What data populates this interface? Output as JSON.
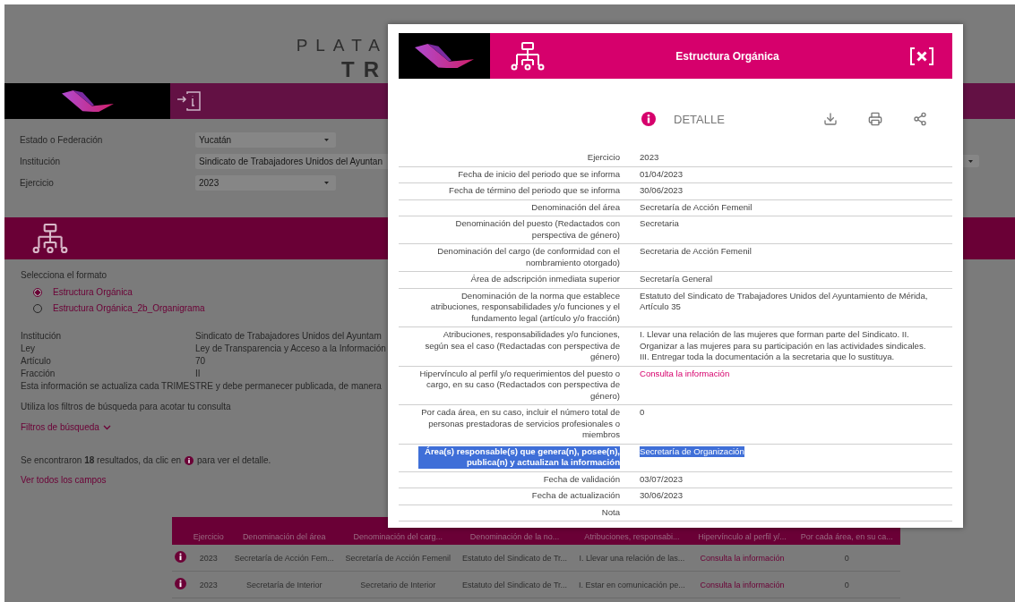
{
  "header": {
    "title_line_1": "PLATA",
    "title_line_2": "TR"
  },
  "filters": [
    {
      "label": "Estado o Federación",
      "value": "Yucatán",
      "kind": "select"
    },
    {
      "label": "Institución",
      "value": "Sindicato de Trabajadores Unidos del Ayuntan",
      "kind": "wide"
    },
    {
      "label": "Ejercicio",
      "value": "2023",
      "kind": "select"
    }
  ],
  "format": {
    "prompt": "Selecciona el formato",
    "options": [
      {
        "label": "Estructura Orgánica",
        "selected": true
      },
      {
        "label": "Estructura Orgánica_2b_Organigrama",
        "selected": false
      }
    ]
  },
  "info": [
    {
      "label": "Institución",
      "value": "Sindicato de Trabajadores Unidos del Ayuntam"
    },
    {
      "label": "Ley",
      "value": "Ley de Transparencia y Acceso a la Información"
    },
    {
      "label": "Artículo",
      "value": "70"
    },
    {
      "label": "Fracción",
      "value": "II"
    }
  ],
  "notice": "Esta información se actualiza cada TRIMESTRE y debe permanecer publicada, de manera",
  "hint": "Utiliza los filtros de búsqueda para acotar tu consulta",
  "filters_link": "Filtros de búsqueda",
  "results_before": "Se encontraron **18** resultados, da clic en",
  "results_after": "para ver el detalle.",
  "all_fields_link": "Ver todos los campos",
  "table": {
    "columns": [
      {
        "label": "Ejercicio",
        "kind": "text"
      },
      {
        "label": "Denominación del área",
        "kind": "text"
      },
      {
        "label": "Denominación del carg...",
        "kind": "text"
      },
      {
        "label": "Denominación de la no...",
        "kind": "text"
      },
      {
        "label": "Atribuciones, responsabi...",
        "kind": "text"
      },
      {
        "label": "Hipervínculo al perfil y/...",
        "kind": "link"
      },
      {
        "label": "Por cada área, en su ca...",
        "kind": "text"
      }
    ],
    "rows": [
      {
        "cells": [
          "2023",
          "Secretaría de Acción Fem...",
          "Secretaría de Acción Femenil",
          "Estatuto del Sindicato de Tr...",
          "I. Llevar una relación de las...",
          "Consulta la información",
          "0"
        ]
      },
      {
        "cells": [
          "2023",
          "Secretaría de Interior",
          "Secretario de Interior",
          "Estatuto del Sindicato de Tr...",
          "I. Estar en comunicación pe...",
          "Consulta la información",
          "0"
        ]
      }
    ]
  },
  "modal": {
    "title": "Estructura Orgánica",
    "section": "DETALLE",
    "rows": [
      {
        "label": "Ejercicio",
        "value": "2023",
        "kind": "text",
        "highlighted": false
      },
      {
        "label": "Fecha de inicio del periodo que se informa",
        "value": "01/04/2023",
        "kind": "text",
        "highlighted": false
      },
      {
        "label": "Fecha de término del periodo que se informa",
        "value": "30/06/2023",
        "kind": "text",
        "highlighted": false
      },
      {
        "label": "Denominación del área",
        "value": "Secretaría de Acción Femenil",
        "kind": "text",
        "highlighted": false
      },
      {
        "label": "Denominación del puesto (Redactados con perspectiva de género)",
        "value": "Secretaria",
        "kind": "text",
        "highlighted": false
      },
      {
        "label": "Denominación del cargo (de conformidad con el nombramiento otorgado)",
        "value": "Secretaria de Acción Femenil",
        "kind": "text",
        "highlighted": false
      },
      {
        "label": "Área de adscripción inmediata superior",
        "value": "Secretaría General",
        "kind": "text",
        "highlighted": false
      },
      {
        "label": "Denominación de la norma que establece atribuciones, responsabilidades y/o funciones y el fundamento legal (artículo y/o fracción)",
        "value": "Estatuto del Sindicato de Trabajadores Unidos del Ayuntamiento de Mérida, Artículo 35",
        "kind": "text",
        "highlighted": false
      },
      {
        "label": "Atribuciones, responsabilidades y/o funciones, según sea el caso (Redactadas con perspectiva de género)",
        "value": "I. Llevar una relación de las mujeres que forman parte del Sindicato. II. Organizar a las mujeres para su participación en las actividades sindicales. III. Entregar toda la documentación a la secretaria que lo sustituya.",
        "kind": "text",
        "highlighted": false
      },
      {
        "label": "Hipervínculo al perfil y/o requerimientos del puesto o cargo, en su caso (Redactados con perspectiva de género)",
        "value": "Consulta la información",
        "kind": "link",
        "highlighted": false
      },
      {
        "label": "Por cada área, en su caso, incluir el número total de personas prestadoras de servicios profesionales o miembros",
        "value": "0",
        "kind": "text",
        "highlighted": false
      },
      {
        "label": "Área(s) responsable(s) que genera(n), posee(n), publica(n) y actualizan la información",
        "value": "Secretaría de Organización",
        "kind": "text",
        "highlighted": true
      },
      {
        "label": "Fecha de validación",
        "value": "03/07/2023",
        "kind": "text",
        "highlighted": false
      },
      {
        "label": "Fecha de actualización",
        "value": "30/06/2023",
        "kind": "text",
        "highlighted": false
      },
      {
        "label": "Nota",
        "highlighted": false
      }
    ]
  }
}
